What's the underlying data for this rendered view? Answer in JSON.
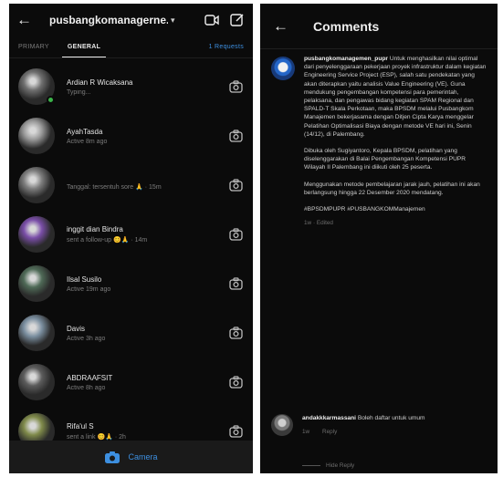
{
  "dm": {
    "header": {
      "title": "pusbangkomanagerne...",
      "chevron": "▾"
    },
    "tabs": {
      "primary": "PRIMARY",
      "general": "GENERAL",
      "requests": "1 Requests"
    },
    "threads": [
      {
        "name": "Ardian R Wicaksana",
        "sub": "Typing...",
        "avatar": "#6f6f6f",
        "online": true
      },
      {
        "name": "AyahTasda",
        "sub": "Active 8m ago",
        "avatar": "#9a9a9a",
        "online": false
      },
      {
        "name": "",
        "sub": "Tanggal: tersentuh sore 🙏 · 15m",
        "avatar": "#7d7d7d",
        "online": false
      },
      {
        "name": "inggit dian Bindra",
        "sub": "sent a follow-up 😊🙏 · 14m",
        "avatar": "#7a4ea8",
        "online": false
      },
      {
        "name": "Ilsal Susilo",
        "sub": "Active 19m ago",
        "avatar": "#4f6a57",
        "online": false
      },
      {
        "name": "Davis",
        "sub": "Active 3h ago",
        "avatar": "#7b8fa0",
        "online": false
      },
      {
        "name": "ABDRAAFSIT",
        "sub": "Active 8h ago",
        "avatar": "#5c5c5c",
        "online": false
      },
      {
        "name": "Rifa'ul S",
        "sub": "sent a link 😊🙏 · 2h",
        "avatar": "#7f8a4a",
        "online": false
      }
    ],
    "camera_bar": {
      "label": "Camera"
    }
  },
  "comments": {
    "header": {
      "title": "Comments"
    },
    "post": {
      "username": "pusbangkomanagemen_pupr",
      "paragraphs": [
        "Untuk menghasilkan nilai optimal dari penyelenggaraan pekerjaan proyek infrastruktur dalam kegiatan Engineering Service Project (ESP), salah satu pendekatan yang akan diterapkan yaitu analisis Value Engineering (VE). Guna mendukung pengembangan kompetensi para pemerintah, pelaksana, dan pengawas bidang kegiatan SPAM Regional dan SPALD-T Skala Perkotaan, maka BPSDM melalui Pusbangkom Manajemen bekerjasama dengan Ditjen Cipta Karya menggelar Pelatihan Optimalisasi Biaya dengan metode VE hari ini, Senin (14/12), di Palembang.",
        "Dibuka oleh Sugiyantoro, Kepala BPSDM, pelatihan yang diselenggarakan di Balai Pengembangan Kompetensi PUPR Wilayah II Palembang ini diikuti oleh 25 peserta.",
        "Menggunakan metode pembelajaran jarak jauh, pelatihan ini akan berlangsung hingga 22 Desember 2020 mendatang.",
        "#BPSDMPUPR #PUSBANGKOMManajemen"
      ],
      "meta": "1w · Edited"
    },
    "comment": {
      "username": "andakkkarmassani",
      "text": "Boleh daftar untuk umum",
      "time": "1w",
      "reply": "Reply",
      "hide_replies": "Hide Reply"
    }
  }
}
